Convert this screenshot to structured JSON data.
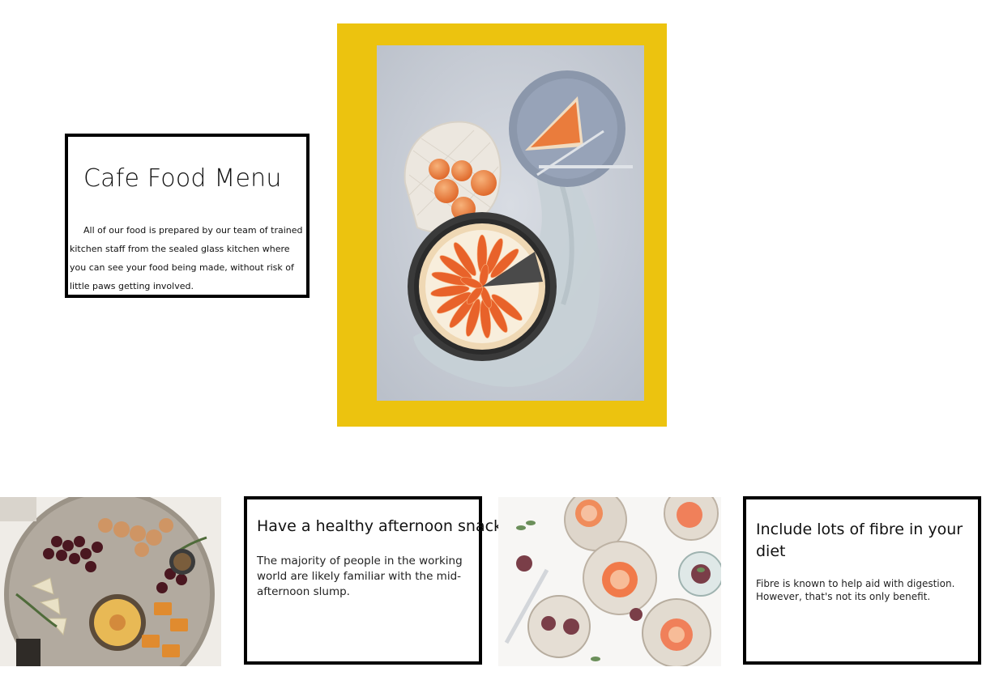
{
  "intro": {
    "title": "Cafe Food Menu",
    "text": "All of our food is prepared by our team of trained kitchen staff from the sealed glass kitchen where you can see your food being made, without risk of little paws getting involved."
  },
  "feature": {
    "frame_color": "#ecc30f"
  },
  "cards": [
    {
      "title": "Have a healthy afternoon snack",
      "text": "The majority of people in the working world are likely familiar with the mid-afternoon slump."
    },
    {
      "title": "Include lots of fibre in your diet",
      "text": "Fibre is known to help aid with digestion. However, that's not its only benefit."
    }
  ]
}
